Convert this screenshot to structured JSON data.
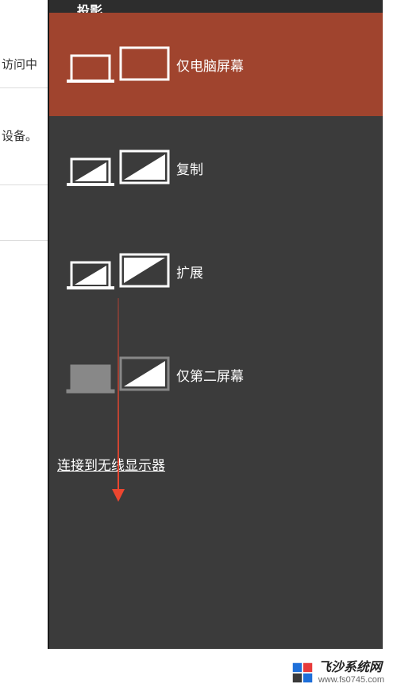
{
  "background": {
    "text1": "访问中",
    "text2": "设备。"
  },
  "panel": {
    "title": "投影",
    "options": [
      {
        "label": "仅电脑屏幕",
        "selected": true
      },
      {
        "label": "复制",
        "selected": false
      },
      {
        "label": "扩展",
        "selected": false
      },
      {
        "label": "仅第二屏幕",
        "selected": false
      }
    ],
    "wireless_link": "连接到无线显示器"
  },
  "watermark": {
    "title": "飞沙系统网",
    "url": "www.fs0745.com"
  }
}
